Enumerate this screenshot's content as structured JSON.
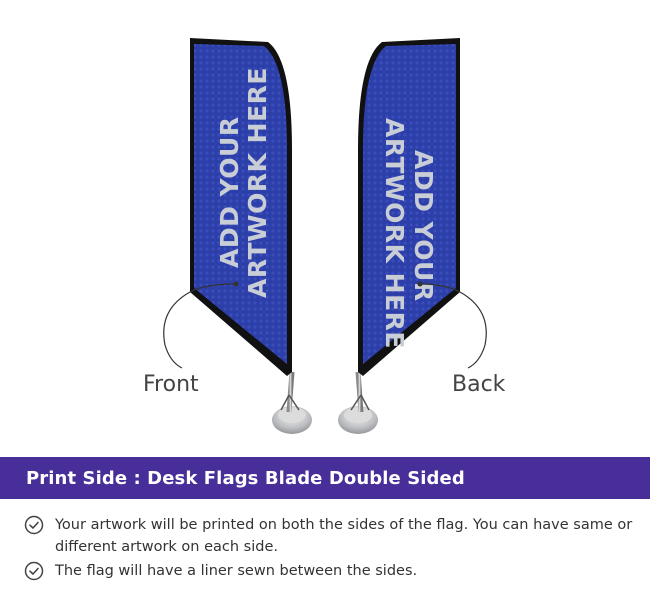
{
  "flags": {
    "front": {
      "line1": "ADD YOUR",
      "line2": "ARTWORK HERE",
      "label": "Front"
    },
    "back": {
      "line1": "ADD YOUR",
      "line2": "ARTWORK HERE",
      "label": "Back"
    },
    "color": "#2c3ea8"
  },
  "banner": {
    "title": "Print Side : Desk Flags Blade Double Sided",
    "color": "#472e99"
  },
  "features": [
    {
      "icon": "check-circle-icon",
      "text": "Your artwork will be printed on both the sides of the flag. You can have same or different artwork on each side."
    },
    {
      "icon": "check-circle-icon",
      "text": "The flag will have a liner sewn between the sides."
    }
  ]
}
